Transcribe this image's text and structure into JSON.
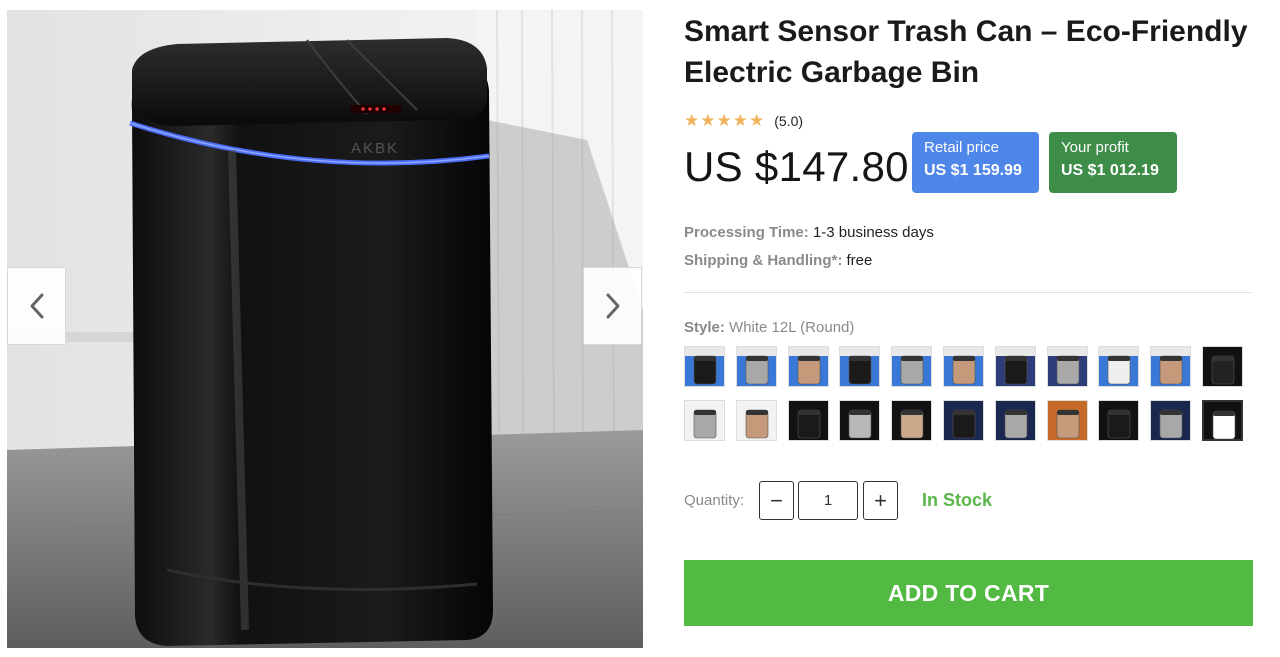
{
  "product": {
    "title": "Smart Sensor Trash Can – Eco-Friendly Electric Garbage Bin",
    "image_brand_text": "AKBK",
    "rating": 5.0,
    "rating_text": "(5.0)",
    "stars": 5,
    "price": "US $147.80"
  },
  "badges": {
    "retail_label": "Retail price",
    "retail_value": "US $1 159.99",
    "profit_label": "Your profit",
    "profit_value": "US $1 012.19",
    "retail_color": "#4e86ea",
    "profit_color": "#3d8c48"
  },
  "details": {
    "processing_label": "Processing Time:",
    "processing_value": "1-3 business days",
    "shipping_label": "Shipping & Handling*:",
    "shipping_value": "free"
  },
  "style": {
    "label": "Style:",
    "selected": "White 12L (Round)",
    "swatch_count": 22,
    "selected_index": 21
  },
  "quantity": {
    "label": "Quantity:",
    "value": "1",
    "minus_symbol": "−",
    "plus_symbol": "+"
  },
  "stock_status": "In Stock",
  "cart": {
    "button_label": "ADD TO CART",
    "button_color": "#52b943"
  },
  "icons": {
    "prev": "chevron-left-icon",
    "next": "chevron-right-icon",
    "star": "star-icon"
  }
}
